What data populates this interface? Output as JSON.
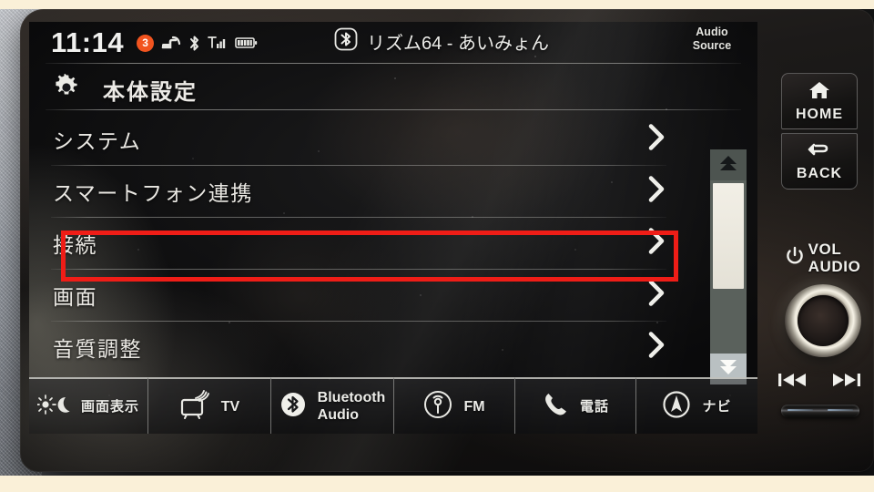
{
  "status_bar": {
    "clock": "11:14",
    "notification_count": "3",
    "icons": [
      "notification-badge",
      "wifi-tether-icon",
      "bluetooth-icon",
      "cellular-signal-icon",
      "battery-icon"
    ],
    "now_playing": {
      "source_icon": "bluetooth-icon",
      "title": "リズム64 - あいみょん"
    },
    "audio_source_button": "Audio\nSource"
  },
  "settings_header": {
    "icon": "gear-icon",
    "title": "本体設定"
  },
  "menu": {
    "items": [
      {
        "label": "システム",
        "chevron": "chevron-right-icon",
        "highlighted": false
      },
      {
        "label": "スマートフォン連携",
        "chevron": "chevron-right-icon",
        "highlighted": false
      },
      {
        "label": "接続",
        "chevron": "chevron-right-icon",
        "highlighted": true
      },
      {
        "label": "画面",
        "chevron": "chevron-right-icon",
        "highlighted": false
      },
      {
        "label": "音質調整",
        "chevron": "chevron-right-icon",
        "highlighted": false
      }
    ]
  },
  "annotation": {
    "target_label": "接続",
    "color": "#ef1d17"
  },
  "scrollbar": {
    "up_icon": "double-chevron-up-icon",
    "down_icon": "double-chevron-down-icon"
  },
  "source_bar": {
    "buttons": [
      {
        "label": "画面表示",
        "icon": "brightness-moon-icon"
      },
      {
        "label": "TV",
        "icon": "tv-icon"
      },
      {
        "label": "Bluetooth\nAudio",
        "icon": "bluetooth-icon"
      },
      {
        "label": "FM",
        "icon": "radio-broadcast-icon"
      },
      {
        "label": "電話",
        "icon": "phone-handset-icon"
      },
      {
        "label": "ナビ",
        "icon": "navigation-compass-icon"
      }
    ]
  },
  "hardware": {
    "home_button": {
      "label": "HOME",
      "icon": "home-icon"
    },
    "back_button": {
      "label": "BACK",
      "icon": "back-arrow-icon"
    },
    "volume": {
      "line1": "VOL",
      "line2": "AUDIO",
      "icon": "power-icon"
    },
    "prev_track": "previous-track-icon",
    "next_track": "next-track-icon"
  },
  "colors": {
    "accent_badge": "#f2541f",
    "annotation": "#ef1d17",
    "screen_text": "#e9e7e2",
    "scrollbar_thumb": "#f2efe6"
  }
}
